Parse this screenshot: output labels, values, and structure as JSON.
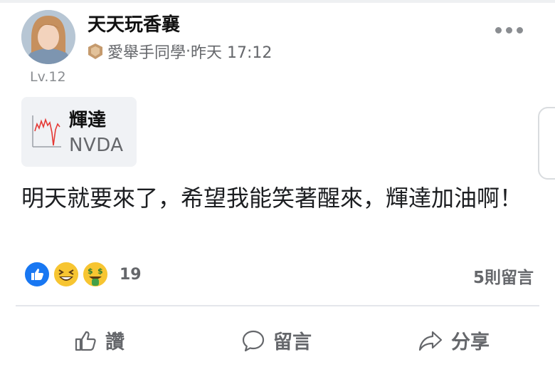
{
  "post": {
    "username": "天天玩香襄",
    "level": "Lv.12",
    "group": "愛舉手同學",
    "separator": " · ",
    "time": "昨天 17:12",
    "text": "明天就要來了，希望我能笑著醒來，輝達加油啊！"
  },
  "stock": {
    "name": "輝達",
    "code": "NVDA"
  },
  "reactions": {
    "icons": [
      "like-icon",
      "laughing-icon",
      "money-face-icon"
    ],
    "count": "19"
  },
  "comments": {
    "label": "5則留言"
  },
  "actions": {
    "like_label": "讚",
    "comment_label": "留言",
    "share_label": "分享"
  },
  "colors": {
    "like_blue": "#1877f2",
    "emoji_yellow": "#f7c531",
    "sparkline_red": "#e53935",
    "muted_text": "#65676b"
  }
}
